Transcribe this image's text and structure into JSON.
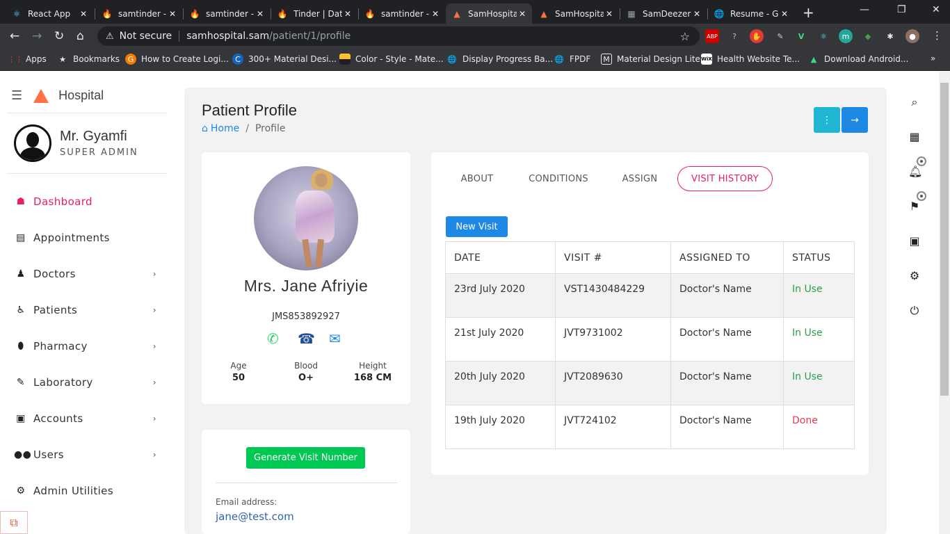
{
  "browser": {
    "tabs": [
      {
        "title": "React App",
        "icon": "react-icon",
        "active": false
      },
      {
        "title": "samtinder -",
        "icon": "firebase-icon",
        "active": false
      },
      {
        "title": "samtinder -",
        "icon": "firebase-icon",
        "active": false
      },
      {
        "title": "Tinder | Dat",
        "icon": "tinder-icon",
        "active": false
      },
      {
        "title": "samtinder -",
        "icon": "firebase-icon",
        "active": false
      },
      {
        "title": "SamHospita",
        "icon": "hospital-logo-icon",
        "active": true
      },
      {
        "title": "SamHospita",
        "icon": "hospital-logo-icon",
        "active": false
      },
      {
        "title": "SamDeezer",
        "icon": "deezer-icon",
        "active": false
      },
      {
        "title": "Resume - G",
        "icon": "globe-icon",
        "active": false
      }
    ],
    "address": {
      "security": "Not secure",
      "host": "samhospital.sam",
      "path": "/patient/1/profile"
    },
    "bookmarks": [
      {
        "label": "Apps",
        "icon": "apps-grid-icon"
      },
      {
        "label": "Bookmarks",
        "icon": "star-icon"
      },
      {
        "label": "How to Create Logi...",
        "icon": "bookmark-site-icon"
      },
      {
        "label": "300+ Material Desi...",
        "icon": "bookmark-site-icon"
      },
      {
        "label": "Color - Style - Mate...",
        "icon": "bookmark-site-icon"
      },
      {
        "label": "Display Progress Ba...",
        "icon": "globe-icon"
      },
      {
        "label": "FPDF",
        "icon": "globe-icon"
      },
      {
        "label": "Material Design Lite",
        "icon": "bookmark-site-icon"
      },
      {
        "label": "Health Website Te...",
        "icon": "wix-icon"
      },
      {
        "label": "Download Android...",
        "icon": "android-icon"
      }
    ]
  },
  "sidebar": {
    "brand": "Hospital",
    "user": {
      "name": "Mr. Gyamfi",
      "role": "SUPER ADMIN"
    },
    "items": [
      {
        "label": "Dashboard",
        "icon": "dashboard-icon",
        "active": true,
        "chevron": false
      },
      {
        "label": "Appointments",
        "icon": "calendar-check-icon",
        "active": false,
        "chevron": false
      },
      {
        "label": "Doctors",
        "icon": "doctor-icon",
        "active": false,
        "chevron": true
      },
      {
        "label": "Patients",
        "icon": "wheelchair-icon",
        "active": false,
        "chevron": true
      },
      {
        "label": "Pharmacy",
        "icon": "pills-icon",
        "active": false,
        "chevron": true
      },
      {
        "label": "Laboratory",
        "icon": "syringe-icon",
        "active": false,
        "chevron": true
      },
      {
        "label": "Accounts",
        "icon": "money-icon",
        "active": false,
        "chevron": true
      },
      {
        "label": "Users",
        "icon": "users-icon",
        "active": false,
        "chevron": true
      },
      {
        "label": "Admin Utilities",
        "icon": "cogs-icon",
        "active": false,
        "chevron": false
      }
    ]
  },
  "header": {
    "title": "Patient Profile",
    "breadcrumb": {
      "home": "Home",
      "separator": "/",
      "current": "Profile"
    }
  },
  "profile": {
    "name": "Mrs. Jane Afriyie",
    "id": "JMS853892927",
    "stats": [
      {
        "label": "Age",
        "value": "50"
      },
      {
        "label": "Blood",
        "value": "O+"
      },
      {
        "label": "Height",
        "value": "168 CM"
      }
    ],
    "generate_button": "Generate Visit Number",
    "email_label": "Email address:",
    "email": "jane@test.com"
  },
  "tabs": [
    {
      "label": "ABOUT",
      "active": false
    },
    {
      "label": "CONDITIONS",
      "active": false
    },
    {
      "label": "ASSIGN",
      "active": false
    },
    {
      "label": "VISIT HISTORY",
      "active": true
    }
  ],
  "visits": {
    "new_button": "New Visit",
    "columns": [
      "DATE",
      "VISIT #",
      "ASSIGNED TO",
      "STATUS"
    ],
    "rows": [
      {
        "date": "23rd July 2020",
        "visit": "VST1430484229",
        "assigned": "Doctor's Name",
        "status": "In Use"
      },
      {
        "date": "21st July 2020",
        "visit": "JVT9731002",
        "assigned": "Doctor's Name",
        "status": "In Use"
      },
      {
        "date": "20th July 2020",
        "visit": "JVT2089630",
        "assigned": "Doctor's Name",
        "status": "In Use"
      },
      {
        "date": "19th July 2020",
        "visit": "JVT724102",
        "assigned": "Doctor's Name",
        "status": "Done"
      }
    ]
  },
  "colors": {
    "accent_pink": "#e91e63",
    "primary_blue": "#1e88e5",
    "cyan": "#1fb5d3",
    "success_green": "#00c853"
  }
}
